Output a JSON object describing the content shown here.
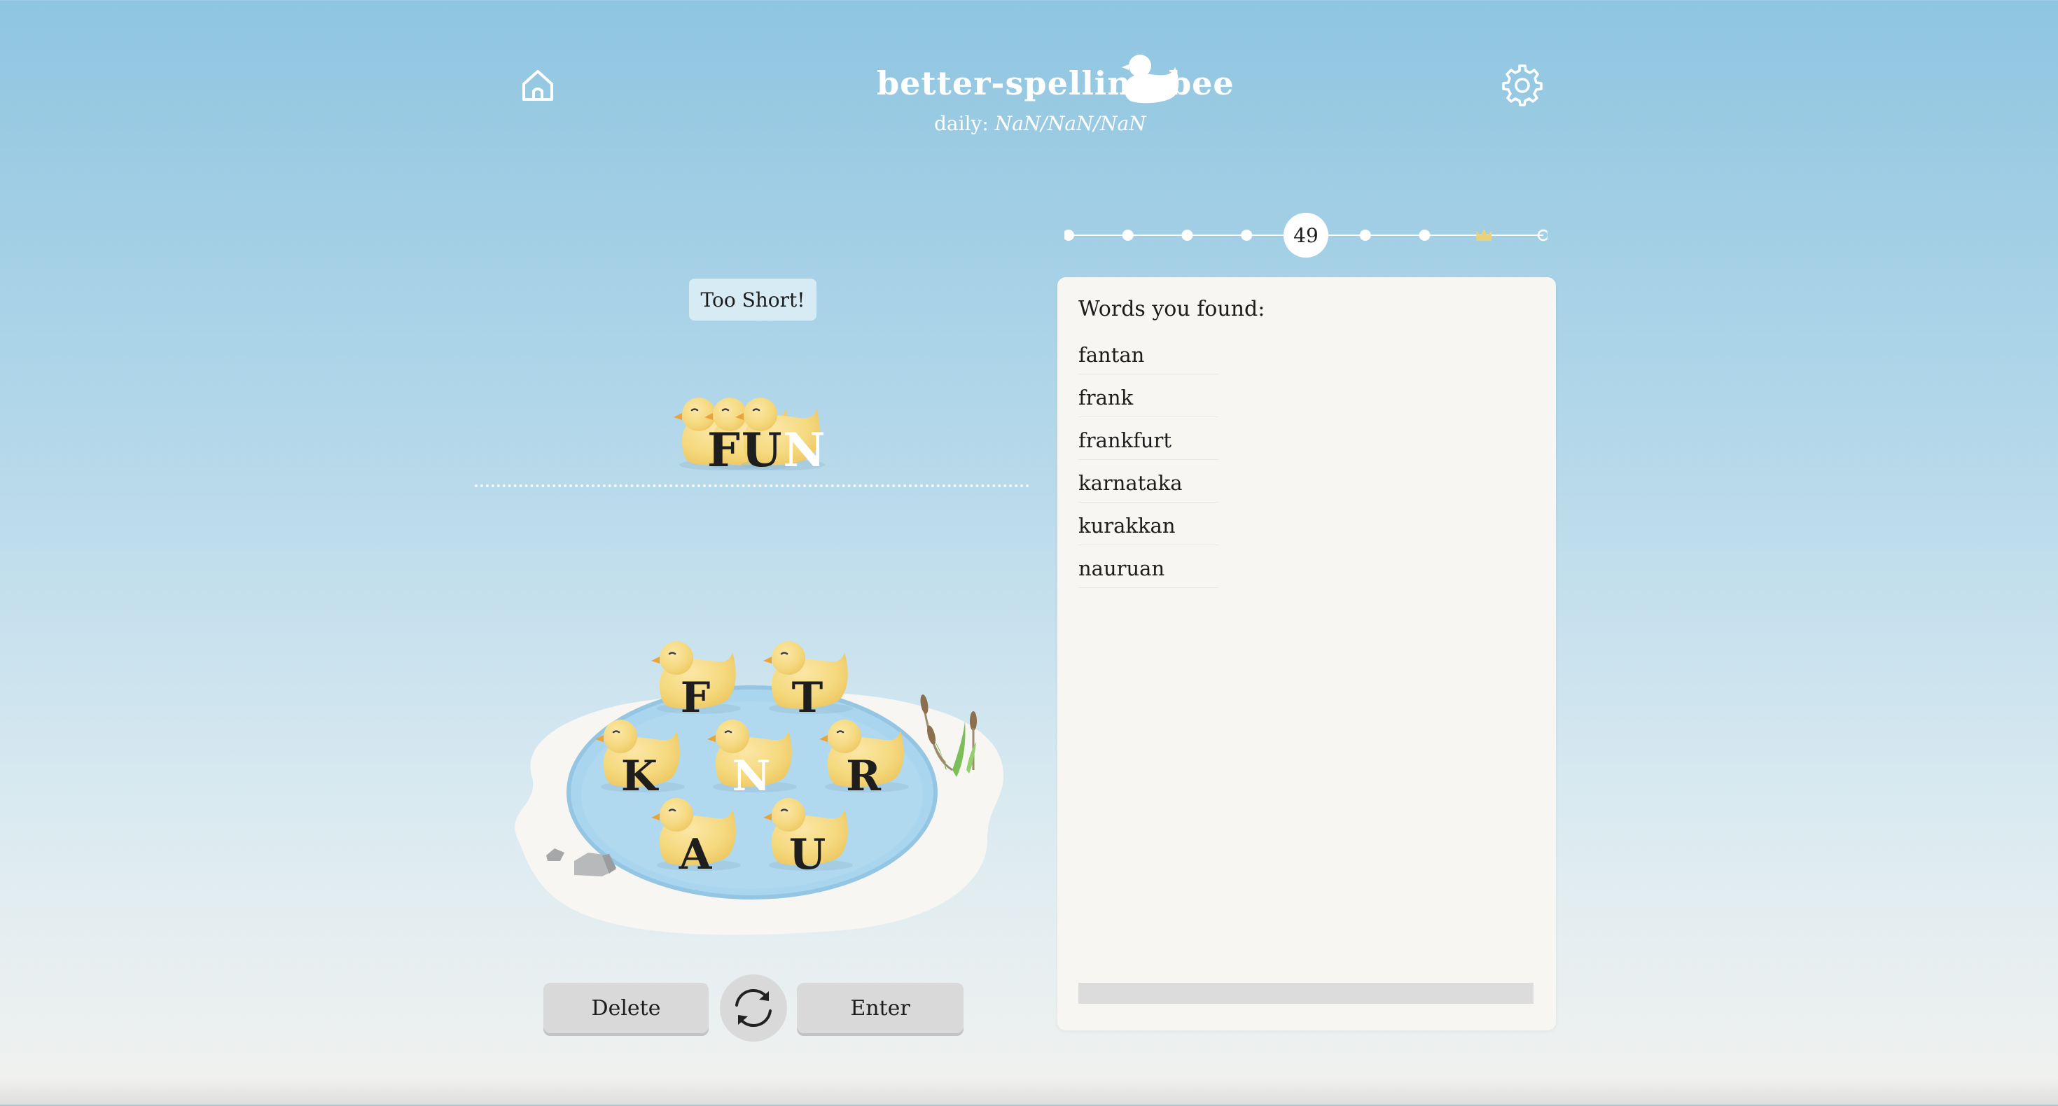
{
  "header": {
    "title": "better-spelling-bee",
    "daily_label": "daily:",
    "daily_date": "NaN/NaN/NaN",
    "home_icon": "home-icon",
    "settings_icon": "gear-icon"
  },
  "progress": {
    "score": "49",
    "current_step": 4,
    "total_steps": 9,
    "milestone_icon": "crown-icon"
  },
  "message": "Too Short!",
  "current_word": {
    "letters": [
      "F",
      "U",
      "N"
    ],
    "highlight_index": 2
  },
  "letters": {
    "center": "N",
    "outer": [
      "F",
      "T",
      "K",
      "R",
      "A",
      "U"
    ]
  },
  "controls": {
    "delete_label": "Delete",
    "enter_label": "Enter",
    "shuffle_icon": "shuffle-icon"
  },
  "found_words": {
    "title": "Words you found:",
    "words": [
      "fantan",
      "frank",
      "frankfurt",
      "karnataka",
      "kurakkan",
      "nauruan"
    ]
  },
  "colors": {
    "duck_yellow": "#f5d97e",
    "pond_blue": "#a9d5ef",
    "highlight_letter": "#ffffff"
  }
}
